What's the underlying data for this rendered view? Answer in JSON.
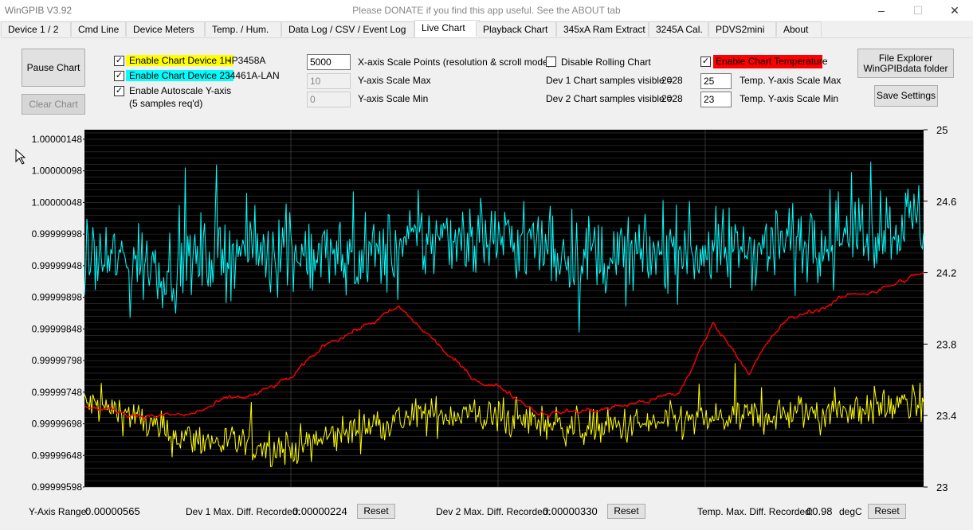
{
  "window": {
    "title": "WinGPIB   V3.92",
    "banner": "Please DONATE if you find this app useful. See the ABOUT tab",
    "minimize": "–",
    "maximize": "☐",
    "close": "✕"
  },
  "tabs": [
    {
      "label": "Device 1 / 2"
    },
    {
      "label": "Cmd Line"
    },
    {
      "label": "Device Meters"
    },
    {
      "label": "Temp. / Hum."
    },
    {
      "label": "Data Log / CSV / Event Log"
    },
    {
      "label": "Live Chart"
    },
    {
      "label": "Playback Chart"
    },
    {
      "label": "345xA Ram Extract"
    },
    {
      "label": "3245A Cal."
    },
    {
      "label": "PDVS2mini"
    },
    {
      "label": "About"
    }
  ],
  "controls": {
    "pause_chart": "Pause Chart",
    "clear_chart": "Clear Chart",
    "dev1_enable_label": "Enable Chart Device 1 -",
    "dev1_name": "HP3458A",
    "dev2_enable_label": "Enable Chart Device 2 -",
    "dev2_name": "34461A-LAN",
    "autoscale_label": "Enable Autoscale Y-axis",
    "autoscale_note": "(5 samples req'd)",
    "x_points_value": "5000",
    "x_points_label": "X-axis Scale Points (resolution & scroll mode)",
    "y_max_value": "10",
    "y_max_label": "Y-axis Scale Max",
    "y_min_value": "0",
    "y_min_label": "Y-axis Scale Min",
    "rolling_label": "Disable Rolling Chart",
    "dev1_visible_label": "Dev 1 Chart samples visible =",
    "dev1_visible_value": "2028",
    "dev2_visible_label": "Dev 2 Chart samples visible =",
    "dev2_visible_value": "2028",
    "temp_enable_label": "Enable Chart Temperature",
    "temp_max_value": "25",
    "temp_max_label": "Temp. Y-axis Scale Max",
    "temp_min_value": "23",
    "temp_min_label": "Temp. Y-axis Scale Min",
    "file_explorer_line1": "File Explorer",
    "file_explorer_line2": "WinGPIBdata folder",
    "save_settings": "Save Settings",
    "checkmark": "✓"
  },
  "colors": {
    "dev1": "#ffff00",
    "dev2": "#00ffff",
    "temp": "#ff0000",
    "chart_bg": "#000000"
  },
  "chart_data": {
    "type": "line",
    "y_left_ticks": [
      "1.00000148",
      "1.00000098",
      "1.00000048",
      "0.99999998",
      "0.99999948",
      "0.99999898",
      "0.99999848",
      "0.99999798",
      "0.99999748",
      "0.99999698",
      "0.99999648",
      "0.99999598"
    ],
    "ylim_left": [
      0.99999598,
      1.00000163
    ],
    "y_right_ticks": [
      "25",
      "24.6",
      "24.2",
      "23.8",
      "23.4",
      "23"
    ],
    "ylim_right": [
      23,
      25
    ],
    "grid": true,
    "samples": 2028,
    "series": [
      {
        "name": "HP3458A",
        "axis": "left",
        "color": "#ffff00",
        "trend": [
          0.9999973,
          0.99999715,
          0.9999968,
          0.9999967,
          0.99999665,
          0.9999966,
          0.9999968,
          0.999997,
          0.9999971,
          0.99999715,
          0.99999705,
          0.999997,
          0.9999969,
          0.99999695,
          0.999997,
          0.99999705,
          0.9999971,
          0.99999715,
          0.9999972,
          0.99999725,
          0.9999973
        ],
        "noise": 5e-07
      },
      {
        "name": "34461A-LAN",
        "axis": "left",
        "color": "#00ffff",
        "trend": [
          0.9999996,
          0.99999955,
          0.99999945,
          0.99999965,
          0.99999975,
          0.9999997,
          0.9999996,
          0.99999965,
          0.99999985,
          1.0,
          0.9999999,
          0.99999975,
          0.99999965,
          0.9999996,
          0.99999975,
          0.9999997,
          0.9999998,
          0.9999999,
          1.0,
          1.0000001,
          1.0000002
        ],
        "noise": 1.1e-06
      },
      {
        "name": "Temperature",
        "axis": "right",
        "color": "#ff0000",
        "trend": [
          23.45,
          23.42,
          23.4,
          23.4,
          23.48,
          23.52,
          23.62,
          23.82,
          23.9,
          24.0,
          23.82,
          23.62,
          23.55,
          23.42,
          23.42,
          23.44,
          23.48,
          23.52,
          23.92,
          23.65,
          23.92,
          24.0,
          24.08,
          24.12,
          24.2
        ],
        "noise": 0.02
      }
    ]
  },
  "footer": {
    "y_range_label": "Y-Axis Range:",
    "y_range_value": "0.00000565",
    "dev1_diff_label": "Dev 1 Max. Diff. Recorded:",
    "dev1_diff_value": "0.00000224",
    "dev2_diff_label": "Dev 2 Max. Diff. Recorded:",
    "dev2_diff_value": "0.00000330",
    "temp_diff_label": "Temp. Max. Diff. Recorded:",
    "temp_diff_value": "00.98",
    "temp_unit": "degC",
    "reset": "Reset"
  }
}
